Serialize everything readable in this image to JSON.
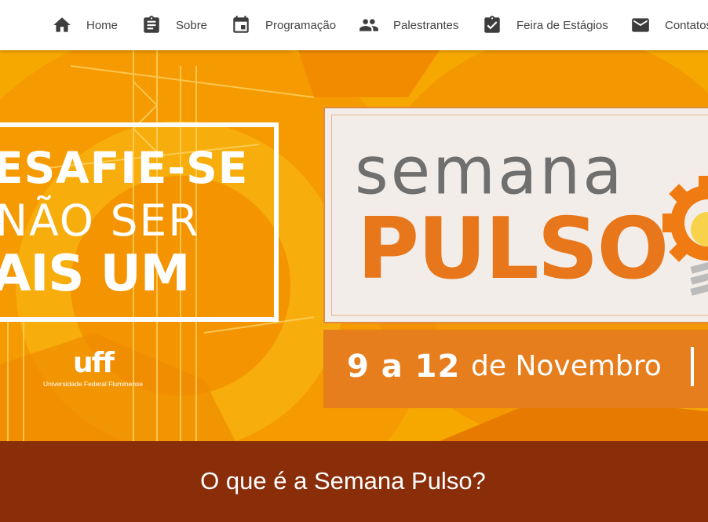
{
  "nav": {
    "items": [
      {
        "label": "Home",
        "icon": "home-icon"
      },
      {
        "label": "Sobre",
        "icon": "clipboard-icon"
      },
      {
        "label": "Programação",
        "icon": "calendar-icon"
      },
      {
        "label": "Palestrantes",
        "icon": "people-icon"
      },
      {
        "label": "Feira de Estágios",
        "icon": "clipboard-check-icon"
      },
      {
        "label": "Contatos",
        "icon": "mail-icon"
      }
    ]
  },
  "banner": {
    "slogan_line1": "ESAFIE-SE",
    "slogan_line2": "NÃO SER",
    "slogan_line3": "AIS UM",
    "logo_mark": "uff",
    "logo_text": "Universidade Federal Fluminense",
    "event_name_top": "semana",
    "event_name_bottom": "PULSO",
    "date_bold": "9 a 12",
    "date_rest": "de Novembro"
  },
  "section": {
    "title": "O que é a Semana Pulso?"
  },
  "colors": {
    "banner_yellow": "#f5a200",
    "brand_orange": "#e67e1e",
    "section_brown": "#8a2e0a"
  }
}
